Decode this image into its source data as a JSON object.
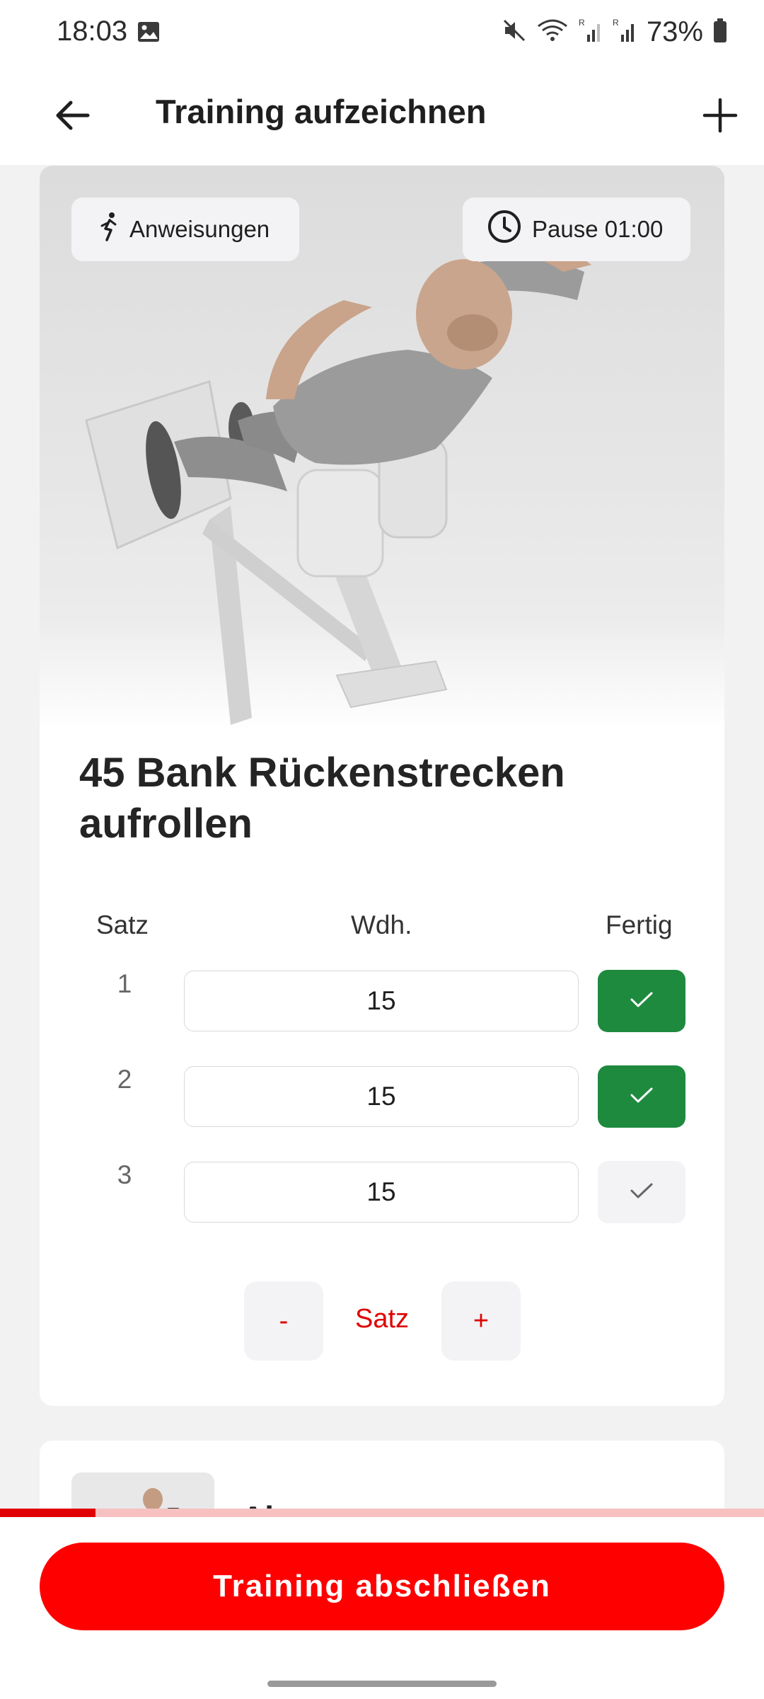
{
  "status_bar": {
    "time": "18:03",
    "battery_percent": "73%",
    "icons": [
      "image-icon",
      "mute-icon",
      "wifi-icon",
      "signal-icon",
      "signal-icon",
      "battery-icon"
    ]
  },
  "app_bar": {
    "title": "Training aufzeichnen",
    "back_icon": "arrow-left-icon",
    "add_icon": "plus-icon"
  },
  "exercise": {
    "instructions_label": "Anweisungen",
    "pause_label": "Pause 01:00",
    "title_line1": "45 Bank Rückenstrecken",
    "title_line2": "aufrollen",
    "columns": {
      "set": "Satz",
      "reps": "Wdh.",
      "done": "Fertig"
    },
    "sets": [
      {
        "number": "1",
        "reps": "15",
        "done": true
      },
      {
        "number": "2",
        "reps": "15",
        "done": true
      },
      {
        "number": "3",
        "reps": "15",
        "done": false
      }
    ],
    "set_stepper": {
      "minus": "-",
      "label": "Satz",
      "plus": "+"
    }
  },
  "next_exercise": {
    "title_partial": "Abr…"
  },
  "progress": {
    "fraction": 0.125
  },
  "finish_button": "Training abschließen",
  "colors": {
    "accent": "#fe0000",
    "accent_text": "#e00000",
    "done_green": "#1e8a3e",
    "progress_track": "#f7c1c1"
  }
}
